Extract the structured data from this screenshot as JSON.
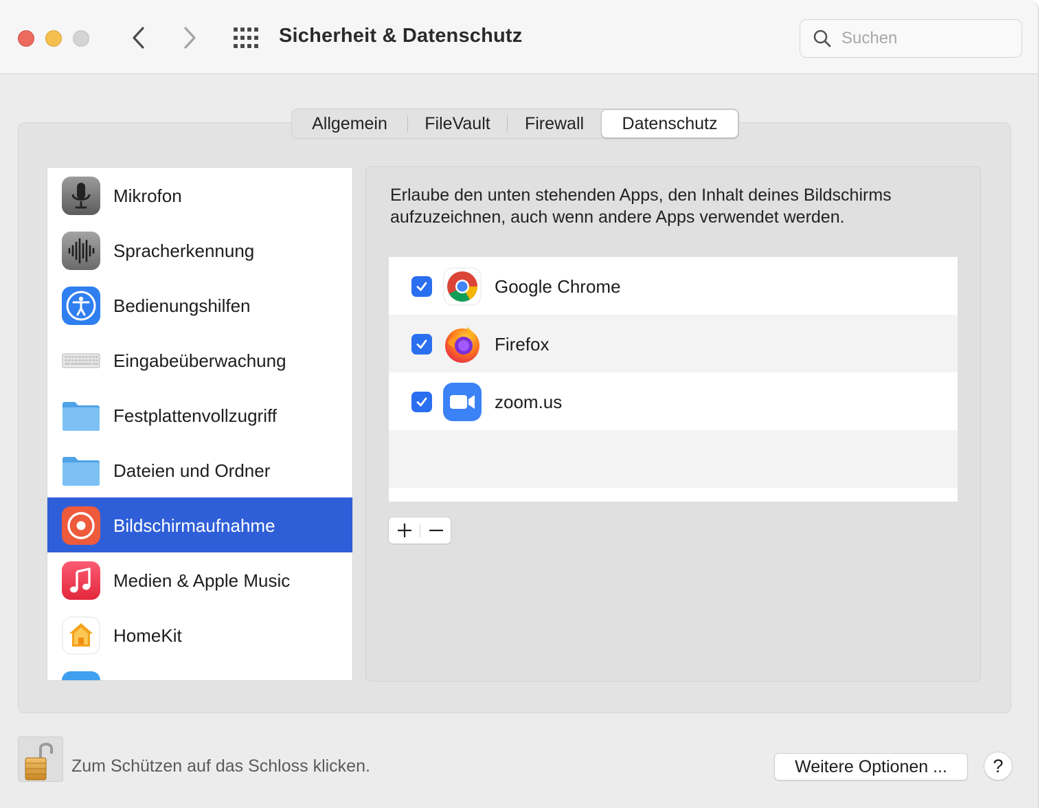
{
  "window": {
    "title": "Sicherheit & Datenschutz",
    "search_placeholder": "Suchen"
  },
  "tabs": [
    {
      "label": "Allgemein",
      "selected": false
    },
    {
      "label": "FileVault",
      "selected": false
    },
    {
      "label": "Firewall",
      "selected": false
    },
    {
      "label": "Datenschutz",
      "selected": true
    }
  ],
  "categories": [
    {
      "label": "Mikrofon",
      "icon": "microphone-icon"
    },
    {
      "label": "Spracherkennung",
      "icon": "waveform-icon"
    },
    {
      "label": "Bedienungshilfen",
      "icon": "accessibility-icon"
    },
    {
      "label": "Eingabeüberwachung",
      "icon": "keyboard-icon"
    },
    {
      "label": "Festplattenvollzugriff",
      "icon": "folder-icon"
    },
    {
      "label": "Dateien und Ordner",
      "icon": "folder-icon"
    },
    {
      "label": "Bildschirmaufnahme",
      "icon": "screen-record-icon",
      "selected": true
    },
    {
      "label": "Medien & Apple Music",
      "icon": "music-icon"
    },
    {
      "label": "HomeKit",
      "icon": "home-icon"
    }
  ],
  "detail": {
    "description": "Erlaube den unten stehenden Apps, den Inhalt deines Bildschirms aufzuzeichnen, auch wenn andere Apps verwendet werden.",
    "apps": [
      {
        "name": "Google Chrome",
        "checked": true,
        "icon": "chrome-icon"
      },
      {
        "name": "Firefox",
        "checked": true,
        "icon": "firefox-icon"
      },
      {
        "name": "zoom.us",
        "checked": true,
        "icon": "zoom-icon"
      }
    ]
  },
  "footer": {
    "lock_text": "Zum Schützen auf das Schloss klicken.",
    "more_options": "Weitere Optionen ...",
    "help": "?"
  },
  "colors": {
    "selection": "#2f5fd8",
    "checkbox": "#2a6ff0"
  }
}
